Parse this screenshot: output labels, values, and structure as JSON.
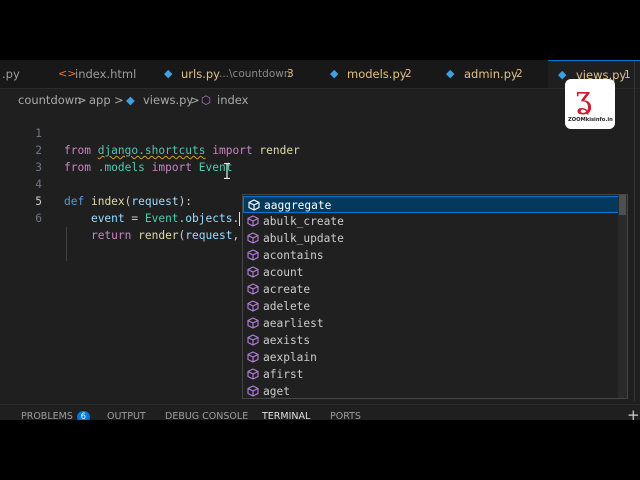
{
  "tabs": [
    {
      "label": ".py",
      "icon": "python-file-icon"
    },
    {
      "label": "index.html",
      "icon": "html-file-icon"
    },
    {
      "label": "urls.py",
      "subtitle": "...\\countdown",
      "count": "3",
      "icon": "python-file-icon"
    },
    {
      "label": "models.py",
      "count": "2",
      "icon": "python-file-icon"
    },
    {
      "label": "admin.py",
      "count": "2",
      "icon": "python-file-icon"
    },
    {
      "label": "views.py",
      "count": "1",
      "icon": "python-file-icon",
      "active": true
    }
  ],
  "breadcrumb": {
    "items": [
      "countdown",
      "app",
      "views.py",
      "index"
    ],
    "separator": ">"
  },
  "code": {
    "line_numbers": [
      "1",
      "2",
      "3",
      "4",
      "5",
      "6"
    ],
    "current_line": "5",
    "l1": {
      "kw1": "from",
      "mod": "django.shortcuts",
      "kw2": "import",
      "name": "render"
    },
    "l2": {
      "kw1": "from",
      "mod": ".models",
      "kw2": "import",
      "name": "Event"
    },
    "l4": {
      "kw": "def",
      "fn": "index",
      "open": "(",
      "param": "request",
      "close": "):"
    },
    "l5": {
      "var": "event",
      "op": " = ",
      "cls": "Event",
      "dot1": ".",
      "attr": "objects",
      "dot2": "."
    },
    "l6": {
      "kw": "return",
      "fn": "render",
      "open": "(",
      "param": "request",
      "comma": ","
    }
  },
  "suggestions": {
    "items": [
      "aaggregate",
      "abulk_create",
      "abulk_update",
      "acontains",
      "acount",
      "acreate",
      "adelete",
      "aearliest",
      "aexists",
      "aexplain",
      "afirst",
      "aget"
    ],
    "selected": "aaggregate",
    "item_icon": "method-cube-icon"
  },
  "panel": {
    "tabs": [
      "PROBLEMS",
      "OUTPUT",
      "DEBUG CONSOLE",
      "TERMINAL",
      "PORTS"
    ],
    "problems_count": "6",
    "add_label": "+"
  },
  "watermark": {
    "text": "ZOOMkisinfo.in"
  },
  "colors": {
    "accent": "#0078d4",
    "editor_bg": "#1f1f1f",
    "keyword": "#c586c0",
    "function": "#dcdcaa",
    "class": "#4ec9b0"
  }
}
